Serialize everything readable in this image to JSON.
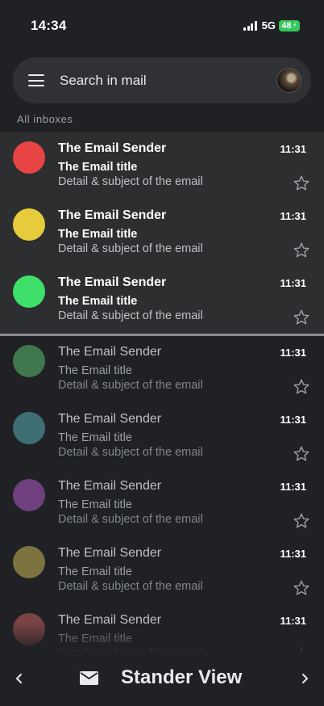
{
  "status_bar": {
    "time": "14:34",
    "network": "5G",
    "battery": "48"
  },
  "search": {
    "placeholder": "Search in mail"
  },
  "section_label": "All inboxes",
  "emails": [
    {
      "sender": "The Email Sender",
      "subject": "The Email title",
      "snippet": "Detail & subject of the email",
      "time": "11:31",
      "color": "#e84444",
      "unread": true
    },
    {
      "sender": "The Email Sender",
      "subject": "The Email title",
      "snippet": "Detail & subject of the email",
      "time": "11:31",
      "color": "#e6cc3c",
      "unread": true
    },
    {
      "sender": "The Email Sender",
      "subject": "The Email title",
      "snippet": "Detail & subject of the email",
      "time": "11:31",
      "color": "#3ee06a",
      "unread": true
    },
    {
      "sender": "The Email Sender",
      "subject": "The Email title",
      "snippet": "Detail & subject of the email",
      "time": "11:31",
      "color": "#5bbf6e",
      "unread": false
    },
    {
      "sender": "The Email Sender",
      "subject": "The Email title",
      "snippet": "Detail & subject of the email",
      "time": "11:31",
      "color": "#5ab0b8",
      "unread": false
    },
    {
      "sender": "The Email Sender",
      "subject": "The Email title",
      "snippet": "Detail & subject of the email",
      "time": "11:31",
      "color": "#b05ac8",
      "unread": false
    },
    {
      "sender": "The Email Sender",
      "subject": "The Email title",
      "snippet": "Detail & subject of the email",
      "time": "11:31",
      "color": "#c8b85a",
      "unread": false
    },
    {
      "sender": "The Email Sender",
      "subject": "The Email title",
      "snippet": "Detail & subject of the email",
      "time": "11:31",
      "color": "#c86060",
      "unread": false
    }
  ],
  "bottom_bar": {
    "view_label": "Stander View",
    "icons": [
      "chevron-left-icon",
      "mail-icon",
      "chevron-right-icon"
    ]
  }
}
